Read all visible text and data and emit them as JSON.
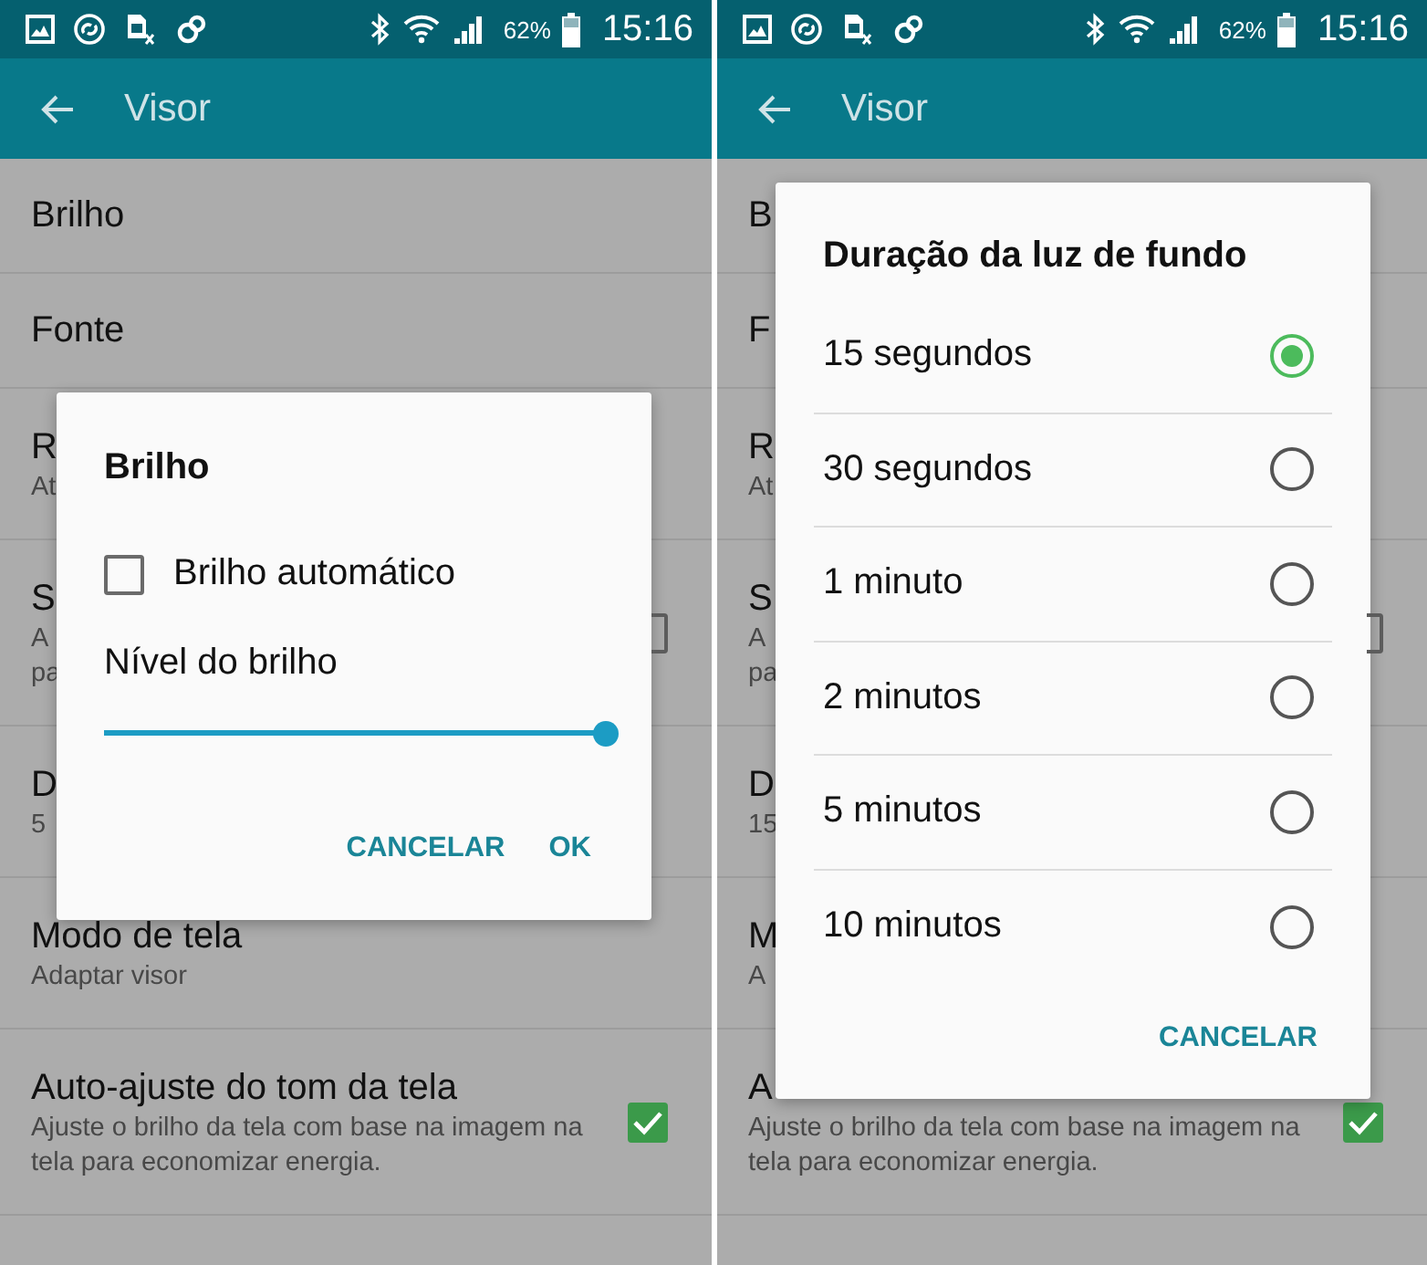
{
  "screens": [
    {
      "status_bar": {
        "battery": "62%",
        "time": "15:16"
      },
      "app_bar": {
        "title": "Visor"
      },
      "settings": [
        {
          "title": "Brilho"
        },
        {
          "title": "Fonte"
        },
        {
          "title": "R",
          "subtitle_lines": [
            "At"
          ]
        },
        {
          "title": "S",
          "subtitle_lines": [
            "A",
            "pa"
          ],
          "checkbox": {
            "checked": false
          }
        },
        {
          "title": "D",
          "subtitle_lines": [
            "5"
          ]
        },
        {
          "title": "Modo de tela",
          "subtitle_lines": [
            "Adaptar visor"
          ]
        },
        {
          "title": "Auto-ajuste do tom da tela",
          "subtitle_lines": [
            "Ajuste o brilho da tela com base na imagem na",
            "tela para economizar energia."
          ],
          "checkbox": {
            "checked": true
          }
        }
      ],
      "dialog": {
        "kind": "slider",
        "title": "Brilho",
        "auto": {
          "label": "Brilho automático",
          "checked": false
        },
        "level_label": "Nível do brilho",
        "level": 1.0,
        "buttons": [
          "CANCELAR",
          "OK"
        ]
      }
    },
    {
      "status_bar": {
        "battery": "62%",
        "time": "15:16"
      },
      "app_bar": {
        "title": "Visor"
      },
      "settings": [
        {
          "title": "B"
        },
        {
          "title": "F"
        },
        {
          "title": "R",
          "subtitle_lines": [
            "At"
          ]
        },
        {
          "title": "S",
          "subtitle_lines": [
            "A",
            "pa"
          ],
          "checkbox": {
            "checked": false
          }
        },
        {
          "title": "D",
          "subtitle_lines": [
            "15"
          ]
        },
        {
          "title": "M",
          "subtitle_lines": [
            "A"
          ]
        },
        {
          "title": "A",
          "subtitle_lines": [
            "Ajuste o brilho da tela com base na imagem na",
            "tela para economizar energia."
          ],
          "checkbox": {
            "checked": true
          }
        }
      ],
      "dialog": {
        "kind": "choice",
        "title": "Duração da luz de fundo",
        "options": [
          {
            "label": "15 segundos",
            "selected": true
          },
          {
            "label": "30 segundos",
            "selected": false
          },
          {
            "label": "1 minuto",
            "selected": false
          },
          {
            "label": "2 minutos",
            "selected": false
          },
          {
            "label": "5 minutos",
            "selected": false
          },
          {
            "label": "10 minutos",
            "selected": false
          }
        ],
        "buttons": [
          "CANCELAR"
        ]
      }
    }
  ]
}
